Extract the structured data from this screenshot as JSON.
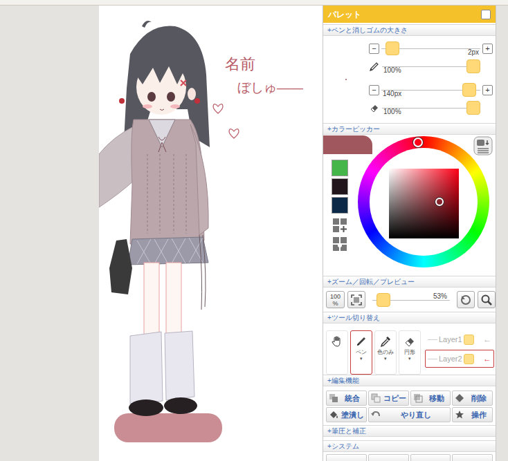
{
  "canvas": {
    "notes": [
      {
        "text": "名前"
      },
      {
        "text": "ぼしゅ——"
      }
    ]
  },
  "palette": {
    "title": "パレット",
    "pinned": false
  },
  "pen_eraser": {
    "heading": "+ペンと消しゴムの大きさ",
    "minus": "−",
    "plus": "+",
    "sliders": [
      {
        "kind": "size",
        "reading": "2px",
        "level": 0.05
      },
      {
        "kind": "pen-opacity",
        "reading": "100%",
        "level": 1
      },
      {
        "kind": "size",
        "reading": "140px",
        "level": 0.95
      },
      {
        "kind": "eraser-opacity",
        "reading": "100%",
        "level": 1
      }
    ]
  },
  "color_picker": {
    "heading": "+カラーピッカー",
    "current_color": "#a0585e",
    "swatches": [
      {
        "color": "#45b649"
      },
      {
        "color": "#20161c"
      },
      {
        "color": "#0c2a48"
      }
    ],
    "hue_level": 0.985,
    "saturation": 0.72,
    "brightness": 0.52
  },
  "zoom": {
    "heading": "+ズーム／回転／プレビュー",
    "reset_top": "100",
    "reset_bottom": "%",
    "reading": "53%",
    "level": 0.07
  },
  "tools": {
    "heading": "+ツール切り替え",
    "items": [
      {
        "kind": "hand",
        "selected": false
      },
      {
        "kind": "pen",
        "label": "ペン",
        "menu": "▾",
        "selected": true
      },
      {
        "kind": "dropper",
        "label": "色のみ",
        "menu": "▾",
        "selected": false
      },
      {
        "kind": "eraser",
        "label": "円形",
        "menu": "▾",
        "selected": false
      }
    ]
  },
  "layers": [
    {
      "label": "Layer1",
      "arrow": "←",
      "selected": false
    },
    {
      "label": "Layer2",
      "arrow": "←",
      "selected": true
    }
  ],
  "edit": {
    "heading": "+編集機能",
    "buttons": [
      {
        "label": "統合",
        "kind": "merge"
      },
      {
        "label": "コピー",
        "kind": "copy"
      },
      {
        "label": "移動",
        "kind": "move"
      },
      {
        "label": "削除",
        "kind": "delete"
      },
      {
        "label": "塗潰し",
        "kind": "fill"
      },
      {
        "label": "やり直し",
        "kind": "redo"
      },
      {
        "label": "操作",
        "kind": "operate"
      }
    ]
  },
  "collapsed_sections": [
    {
      "heading": "+筆圧と補正"
    },
    {
      "heading": "+システム"
    }
  ]
}
